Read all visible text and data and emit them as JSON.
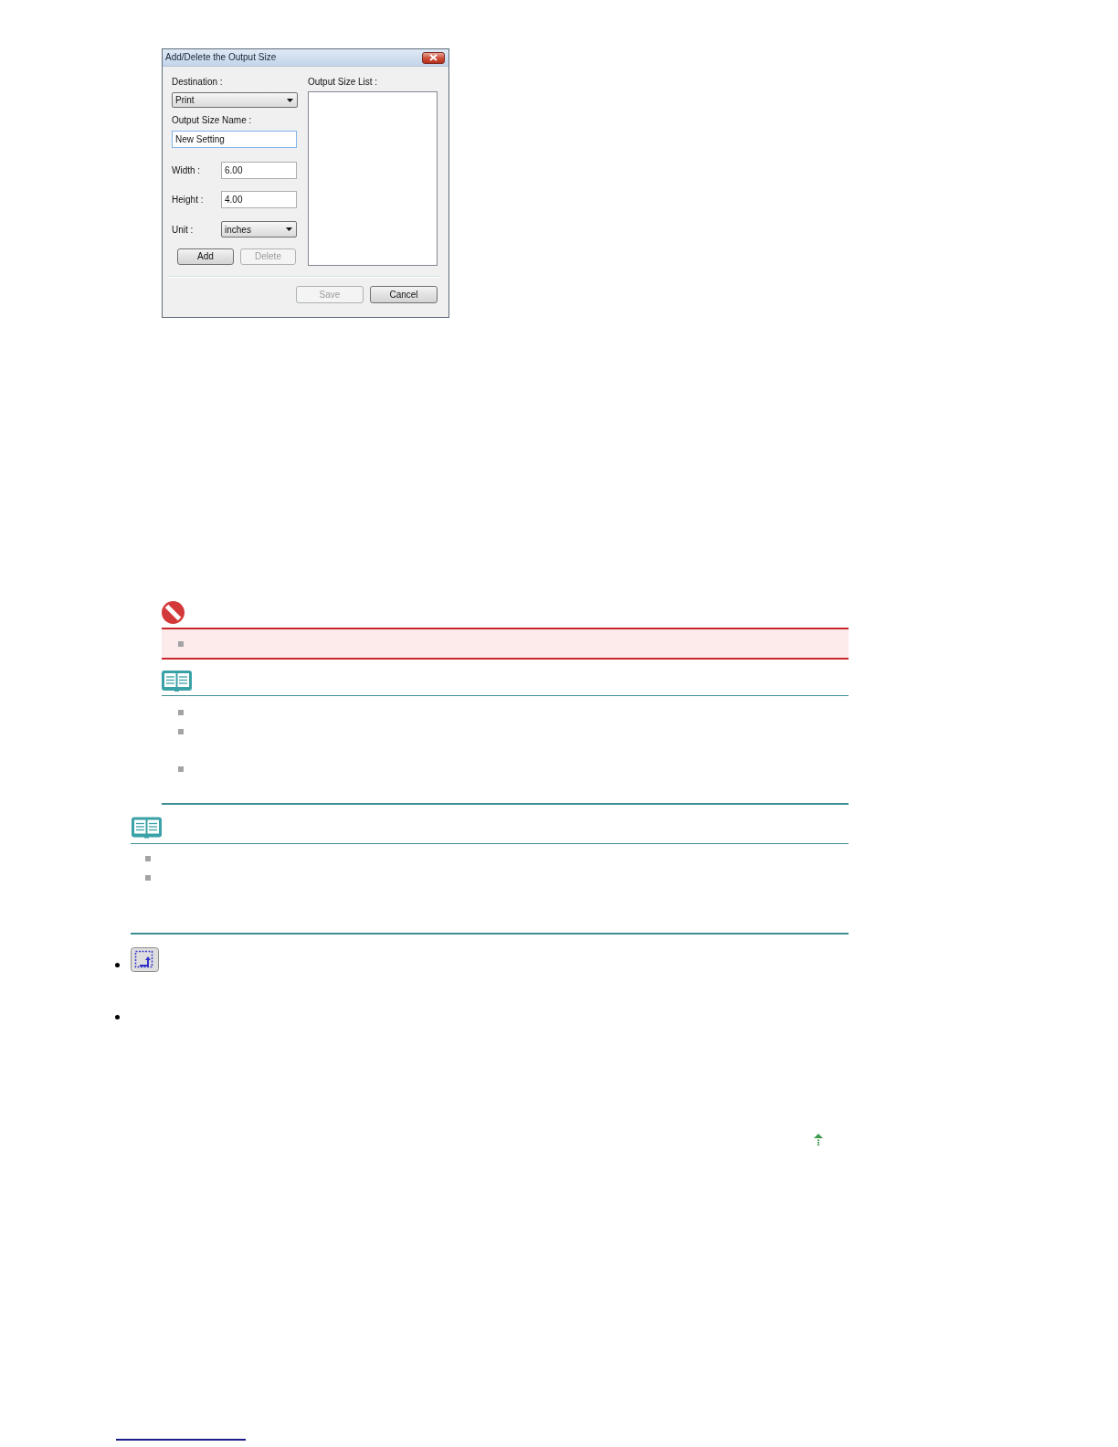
{
  "dialog": {
    "title": "Add/Delete the Output Size",
    "destination": {
      "label": "Destination :",
      "value": "Print"
    },
    "output_size_name": {
      "label": "Output Size Name :",
      "value": "New Setting",
      "focused": true
    },
    "width": {
      "label": "Width :",
      "value": "6.00",
      "focused": false
    },
    "height": {
      "label": "Height :",
      "value": "4.00",
      "focused": false
    },
    "unit": {
      "label": "Unit :",
      "value": "inches"
    },
    "buttons": [
      {
        "label": "Add",
        "disabled": false
      },
      {
        "label": "Delete",
        "disabled": true
      }
    ],
    "output_size_list": {
      "label": "Output Size List :"
    },
    "footer_buttons": [
      {
        "label": "Save",
        "disabled": true
      },
      {
        "label": "Cancel",
        "disabled": false
      }
    ]
  }
}
